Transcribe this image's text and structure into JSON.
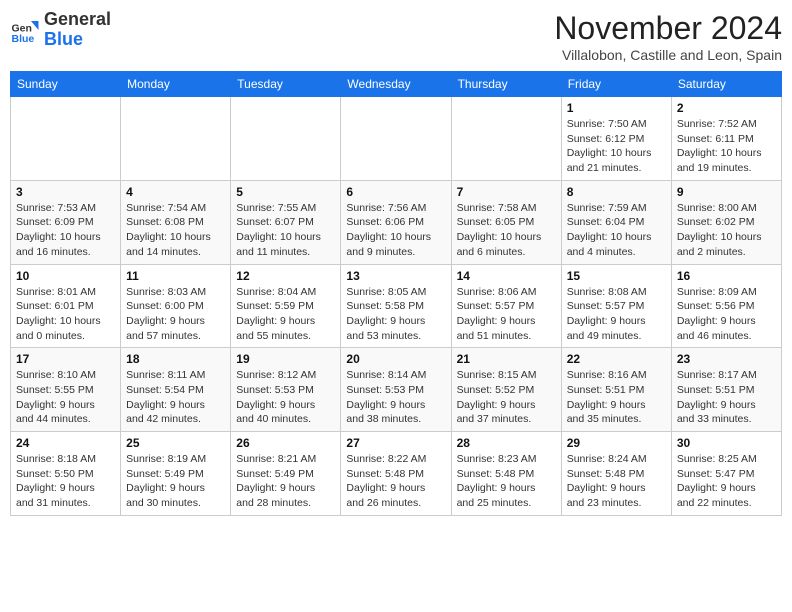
{
  "logo": {
    "general": "General",
    "blue": "Blue"
  },
  "header": {
    "month": "November 2024",
    "location": "Villalobon, Castille and Leon, Spain"
  },
  "days_of_week": [
    "Sunday",
    "Monday",
    "Tuesday",
    "Wednesday",
    "Thursday",
    "Friday",
    "Saturday"
  ],
  "weeks": [
    [
      {
        "day": "",
        "info": ""
      },
      {
        "day": "",
        "info": ""
      },
      {
        "day": "",
        "info": ""
      },
      {
        "day": "",
        "info": ""
      },
      {
        "day": "",
        "info": ""
      },
      {
        "day": "1",
        "info": "Sunrise: 7:50 AM\nSunset: 6:12 PM\nDaylight: 10 hours and 21 minutes."
      },
      {
        "day": "2",
        "info": "Sunrise: 7:52 AM\nSunset: 6:11 PM\nDaylight: 10 hours and 19 minutes."
      }
    ],
    [
      {
        "day": "3",
        "info": "Sunrise: 7:53 AM\nSunset: 6:09 PM\nDaylight: 10 hours and 16 minutes."
      },
      {
        "day": "4",
        "info": "Sunrise: 7:54 AM\nSunset: 6:08 PM\nDaylight: 10 hours and 14 minutes."
      },
      {
        "day": "5",
        "info": "Sunrise: 7:55 AM\nSunset: 6:07 PM\nDaylight: 10 hours and 11 minutes."
      },
      {
        "day": "6",
        "info": "Sunrise: 7:56 AM\nSunset: 6:06 PM\nDaylight: 10 hours and 9 minutes."
      },
      {
        "day": "7",
        "info": "Sunrise: 7:58 AM\nSunset: 6:05 PM\nDaylight: 10 hours and 6 minutes."
      },
      {
        "day": "8",
        "info": "Sunrise: 7:59 AM\nSunset: 6:04 PM\nDaylight: 10 hours and 4 minutes."
      },
      {
        "day": "9",
        "info": "Sunrise: 8:00 AM\nSunset: 6:02 PM\nDaylight: 10 hours and 2 minutes."
      }
    ],
    [
      {
        "day": "10",
        "info": "Sunrise: 8:01 AM\nSunset: 6:01 PM\nDaylight: 10 hours and 0 minutes."
      },
      {
        "day": "11",
        "info": "Sunrise: 8:03 AM\nSunset: 6:00 PM\nDaylight: 9 hours and 57 minutes."
      },
      {
        "day": "12",
        "info": "Sunrise: 8:04 AM\nSunset: 5:59 PM\nDaylight: 9 hours and 55 minutes."
      },
      {
        "day": "13",
        "info": "Sunrise: 8:05 AM\nSunset: 5:58 PM\nDaylight: 9 hours and 53 minutes."
      },
      {
        "day": "14",
        "info": "Sunrise: 8:06 AM\nSunset: 5:57 PM\nDaylight: 9 hours and 51 minutes."
      },
      {
        "day": "15",
        "info": "Sunrise: 8:08 AM\nSunset: 5:57 PM\nDaylight: 9 hours and 49 minutes."
      },
      {
        "day": "16",
        "info": "Sunrise: 8:09 AM\nSunset: 5:56 PM\nDaylight: 9 hours and 46 minutes."
      }
    ],
    [
      {
        "day": "17",
        "info": "Sunrise: 8:10 AM\nSunset: 5:55 PM\nDaylight: 9 hours and 44 minutes."
      },
      {
        "day": "18",
        "info": "Sunrise: 8:11 AM\nSunset: 5:54 PM\nDaylight: 9 hours and 42 minutes."
      },
      {
        "day": "19",
        "info": "Sunrise: 8:12 AM\nSunset: 5:53 PM\nDaylight: 9 hours and 40 minutes."
      },
      {
        "day": "20",
        "info": "Sunrise: 8:14 AM\nSunset: 5:53 PM\nDaylight: 9 hours and 38 minutes."
      },
      {
        "day": "21",
        "info": "Sunrise: 8:15 AM\nSunset: 5:52 PM\nDaylight: 9 hours and 37 minutes."
      },
      {
        "day": "22",
        "info": "Sunrise: 8:16 AM\nSunset: 5:51 PM\nDaylight: 9 hours and 35 minutes."
      },
      {
        "day": "23",
        "info": "Sunrise: 8:17 AM\nSunset: 5:51 PM\nDaylight: 9 hours and 33 minutes."
      }
    ],
    [
      {
        "day": "24",
        "info": "Sunrise: 8:18 AM\nSunset: 5:50 PM\nDaylight: 9 hours and 31 minutes."
      },
      {
        "day": "25",
        "info": "Sunrise: 8:19 AM\nSunset: 5:49 PM\nDaylight: 9 hours and 30 minutes."
      },
      {
        "day": "26",
        "info": "Sunrise: 8:21 AM\nSunset: 5:49 PM\nDaylight: 9 hours and 28 minutes."
      },
      {
        "day": "27",
        "info": "Sunrise: 8:22 AM\nSunset: 5:48 PM\nDaylight: 9 hours and 26 minutes."
      },
      {
        "day": "28",
        "info": "Sunrise: 8:23 AM\nSunset: 5:48 PM\nDaylight: 9 hours and 25 minutes."
      },
      {
        "day": "29",
        "info": "Sunrise: 8:24 AM\nSunset: 5:48 PM\nDaylight: 9 hours and 23 minutes."
      },
      {
        "day": "30",
        "info": "Sunrise: 8:25 AM\nSunset: 5:47 PM\nDaylight: 9 hours and 22 minutes."
      }
    ]
  ]
}
